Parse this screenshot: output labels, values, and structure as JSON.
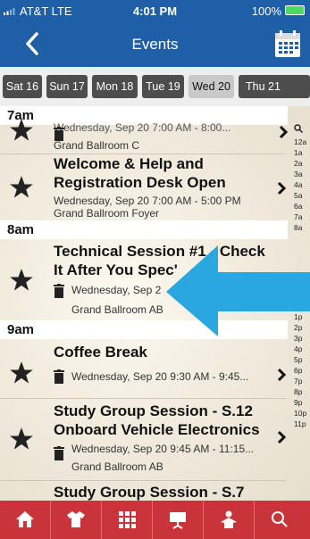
{
  "status": {
    "carrier": "AT&T  LTE",
    "time": "4:01 PM",
    "battery": "100%"
  },
  "header": {
    "title": "Events"
  },
  "dates": [
    {
      "label": "Sat 16",
      "selected": false
    },
    {
      "label": "Sun 17",
      "selected": false
    },
    {
      "label": "Mon 18",
      "selected": false
    },
    {
      "label": "Tue 19",
      "selected": false
    },
    {
      "label": "Wed 20",
      "selected": true
    },
    {
      "label": "Thu 21",
      "selected": false
    }
  ],
  "hours": [
    "7am",
    "8am",
    "9am"
  ],
  "events": [
    {
      "title": "",
      "time": "Wednesday, Sep 20 7:00 AM - 8:00...",
      "room": "Grand Ballroom C"
    },
    {
      "title_line1": "Welcome & Help and",
      "title_line2": "Registration Desk Open",
      "time": "Wednesday, Sep 20 7:00 AM - 5:00 PM",
      "room": "Grand Ballroom Foyer"
    },
    {
      "title_line1": "Technical Session #1 - Check",
      "title_line2": "It After You Spec'",
      "time": "Wednesday, Sep 2",
      "room": "Grand Ballroom AB"
    },
    {
      "title_line1": "Coffee Break",
      "time": "Wednesday, Sep 20 9:30 AM - 9:45..."
    },
    {
      "title_line1": "Study Group Session - S.12",
      "title_line2": "Onboard Vehicle Electronics",
      "time": "Wednesday, Sep 20 9:45 AM - 11:15...",
      "room": "Grand Ballroom AB"
    },
    {
      "title_line1": "Study Group Session - S.7"
    }
  ],
  "index": [
    "12a",
    "1a",
    "2a",
    "3a",
    "4a",
    "5a",
    "6a",
    "7a",
    "8a",
    "1p",
    "2p",
    "3p",
    "4p",
    "5p",
    "6p",
    "7p",
    "8p",
    "9p",
    "10p",
    "11p"
  ],
  "bottom_nav": [
    "home-icon",
    "shirt-icon",
    "grid-icon",
    "presentation-icon",
    "person-icon",
    "search-icon"
  ],
  "colors": {
    "header": "#1f5fa8",
    "bottom_bar": "#c8343a",
    "arrow": "#29a8e0"
  }
}
